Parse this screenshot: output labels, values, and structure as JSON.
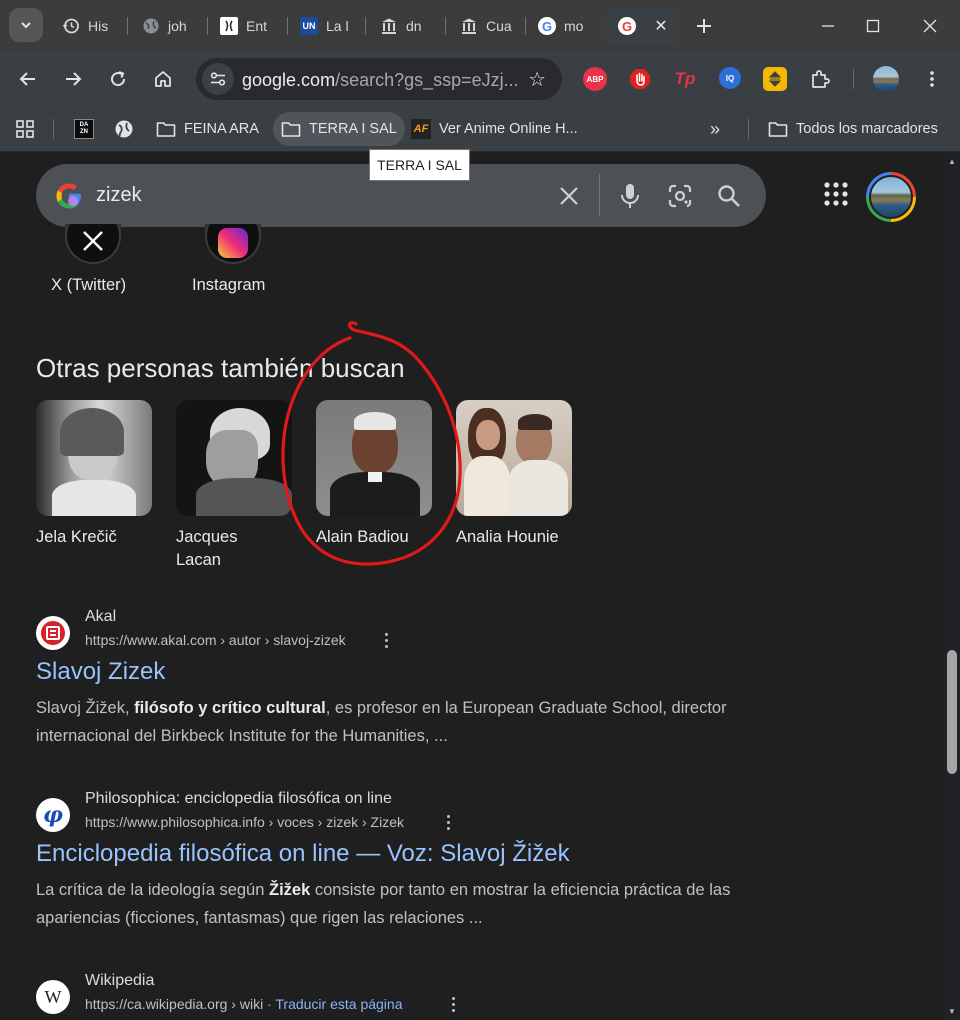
{
  "browser": {
    "tabs": [
      {
        "label": "His",
        "icon": "history-icon"
      },
      {
        "label": "joh",
        "icon": "globe-icon"
      },
      {
        "label": "Ent",
        "icon": "site-icon"
      },
      {
        "label": "La l",
        "icon": "un-icon"
      },
      {
        "label": "dn",
        "icon": "institution-icon"
      },
      {
        "label": "Cua",
        "icon": "institution-icon"
      },
      {
        "label": "mo",
        "icon": "google-icon"
      },
      {
        "label": "",
        "icon": "google-icon",
        "active": true
      }
    ],
    "omnibox": {
      "host": "google.com",
      "path": "/search?gs_ssp=eJzj..."
    },
    "extensions": [
      {
        "name": "adblock-plus-icon",
        "text": "ABP",
        "color": "#e8334a"
      },
      {
        "name": "hand-stop-icon",
        "text": "",
        "color": "#e0211c"
      },
      {
        "name": "tp-extension-icon",
        "text": "Tp",
        "color": "#e8334a"
      },
      {
        "name": "iq-extension-icon",
        "text": "IQ",
        "color": "#2d6fd8"
      },
      {
        "name": "sort-extension-icon",
        "text": "",
        "color": "#f5b800"
      }
    ],
    "bookmarks": [
      {
        "label": "",
        "icon": "dazn-icon"
      },
      {
        "label": "",
        "icon": "globe-icon"
      },
      {
        "label": "FEINA ARA",
        "icon": "folder-icon"
      },
      {
        "label": "TERRA I SAL",
        "icon": "folder-icon"
      },
      {
        "label": "Ver Anime Online H...",
        "icon": "af-icon"
      }
    ],
    "all_bookmarks_label": "Todos los marcadores",
    "tooltip": "TERRA I SAL"
  },
  "search": {
    "query": "zizek"
  },
  "profiles": [
    {
      "label": "X (Twitter)"
    },
    {
      "label": "Instagram"
    }
  ],
  "others": {
    "title": "Otras personas también buscan",
    "people": [
      {
        "name": "Jela Krečič"
      },
      {
        "name": "Jacques Lacan"
      },
      {
        "name": "Alain Badiou"
      },
      {
        "name": "Analia Hounie"
      }
    ]
  },
  "results": [
    {
      "site": "Akal",
      "url": "https://www.akal.com › autor › slavoj-zizek",
      "title": "Slavoj Zizek",
      "snippet_parts": [
        {
          "t": "Slavoj Žižek, ",
          "b": false
        },
        {
          "t": "filósofo y crítico cultural",
          "b": true
        },
        {
          "t": ", es profesor en la European Graduate School, director internacional del Birkbeck Institute for the Humanities, ...",
          "b": false
        }
      ]
    },
    {
      "site": "Philosophica: enciclopedia filosófica on line",
      "url": "https://www.philosophica.info › voces › zizek › Zizek",
      "title": "Enciclopedia filosófica on line — Voz: Slavoj Žižek",
      "snippet_parts": [
        {
          "t": "La crítica de la ideología según ",
          "b": false
        },
        {
          "t": "Žižek",
          "b": true
        },
        {
          "t": " consiste por tanto en mostrar la eficiencia práctica de las apariencias (ficciones, fantasmas) que rigen las relaciones ...",
          "b": false
        }
      ]
    },
    {
      "site": "Wikipedia",
      "url": "https://ca.wikipedia.org › wiki",
      "translate": " · Traducir esta página",
      "title": "",
      "snippet_parts": []
    }
  ]
}
